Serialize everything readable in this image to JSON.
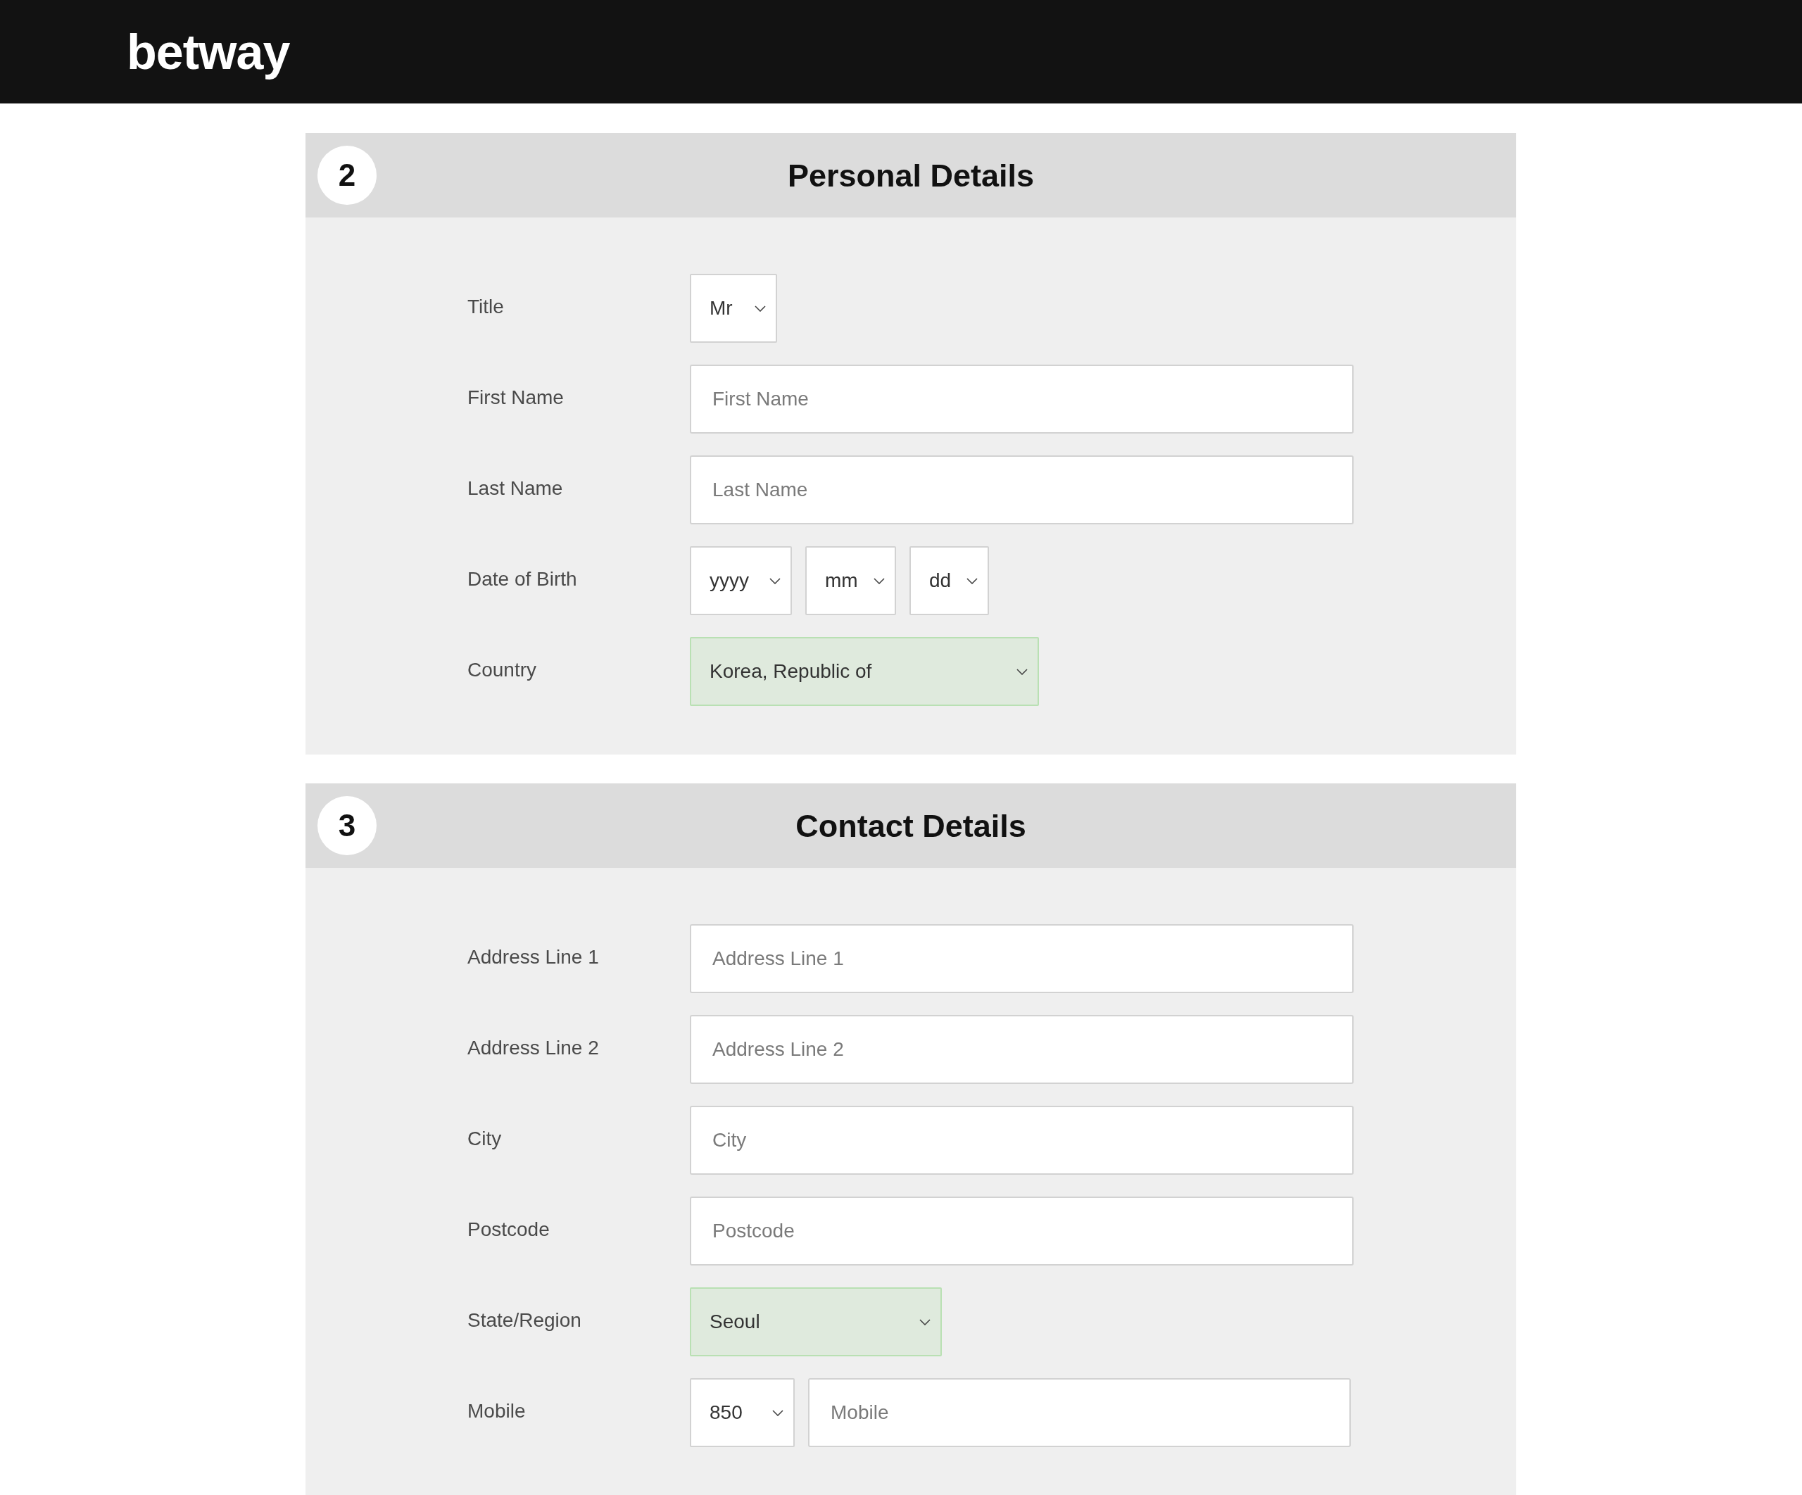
{
  "header": {
    "logo": "betway"
  },
  "sections": [
    {
      "number": "2",
      "title": "Personal Details",
      "fields": [
        {
          "label": "Title",
          "controls": [
            {
              "kind": "select",
              "value": "Mr",
              "valid": false
            }
          ]
        },
        {
          "label": "First Name",
          "controls": [
            {
              "kind": "input",
              "placeholder": "First Name"
            }
          ]
        },
        {
          "label": "Last Name",
          "controls": [
            {
              "kind": "input",
              "placeholder": "Last Name"
            }
          ]
        },
        {
          "label": "Date of Birth",
          "controls": [
            {
              "kind": "select",
              "value": "yyyy",
              "valid": false
            },
            {
              "kind": "select",
              "value": "mm",
              "valid": false
            },
            {
              "kind": "select",
              "value": "dd",
              "valid": false
            }
          ]
        },
        {
          "label": "Country",
          "controls": [
            {
              "kind": "select",
              "value": "Korea, Republic of",
              "valid": true
            }
          ]
        }
      ]
    },
    {
      "number": "3",
      "title": "Contact Details",
      "fields": [
        {
          "label": "Address Line 1",
          "controls": [
            {
              "kind": "input",
              "placeholder": "Address Line 1"
            }
          ]
        },
        {
          "label": "Address Line 2",
          "controls": [
            {
              "kind": "input",
              "placeholder": "Address Line 2"
            }
          ]
        },
        {
          "label": "City",
          "controls": [
            {
              "kind": "input",
              "placeholder": "City"
            }
          ]
        },
        {
          "label": "Postcode",
          "controls": [
            {
              "kind": "input",
              "placeholder": "Postcode"
            }
          ]
        },
        {
          "label": "State/Region",
          "controls": [
            {
              "kind": "select",
              "value": "Seoul",
              "valid": true
            }
          ]
        },
        {
          "label": "Mobile",
          "controls": [
            {
              "kind": "select",
              "value": "850",
              "valid": false
            },
            {
              "kind": "input",
              "placeholder": "Mobile"
            }
          ]
        }
      ]
    }
  ]
}
